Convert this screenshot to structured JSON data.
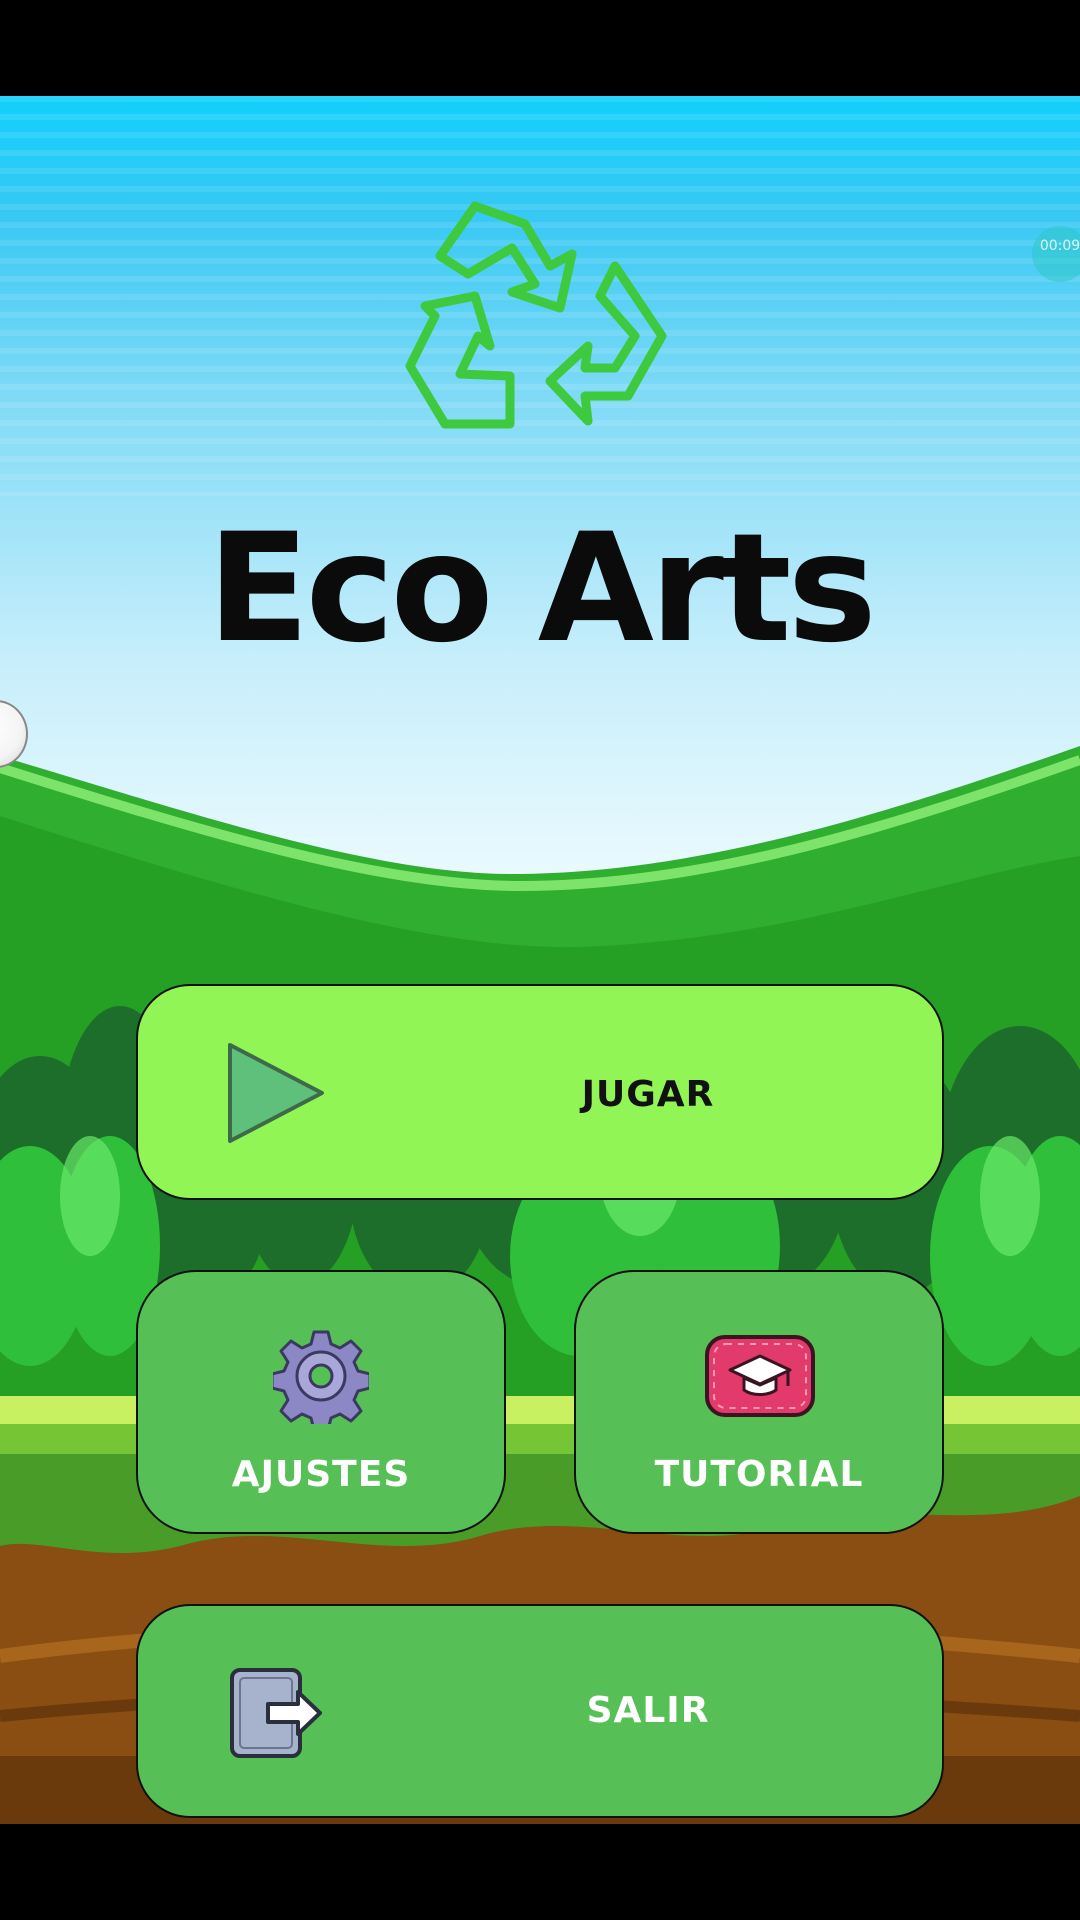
{
  "app": {
    "title": "Eco Arts"
  },
  "timer": {
    "text": "00:09"
  },
  "menu": {
    "play_label": "JUGAR",
    "settings_label": "AJUSTES",
    "tutorial_label": "TUTORIAL",
    "exit_label": "SALIR"
  },
  "icons": {
    "logo": "recycle-icon",
    "play": "play-icon",
    "settings": "gear-icon",
    "tutorial": "graduation-cap-icon",
    "exit": "exit-door-icon"
  },
  "colors": {
    "sky_top": "#10d0fb",
    "sky_bottom": "#eafafe",
    "hill": "#2eb82e",
    "button_green": "#56c056",
    "button_light": "#92f556",
    "logo_green": "#3ec93e",
    "title": "#0b0b0b"
  }
}
